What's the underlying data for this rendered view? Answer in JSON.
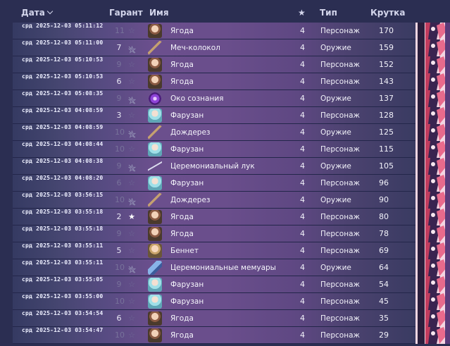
{
  "header": {
    "date_label": "Дата",
    "guarantee_label": "Гарант",
    "name_label": "Имя",
    "rarity_label": "★",
    "type_label": "Тип",
    "roll_label": "Крутка"
  },
  "rows": [
    {
      "date": "срд 2025-12-03 05:11:12",
      "pity": "11",
      "pity_dim": true,
      "mark": "star",
      "mark_dim": true,
      "icon": "char-yagoda-icon",
      "icon_class": "ico-char",
      "name": "Ягода",
      "rarity": "4",
      "type": "Персонаж",
      "roll": "170"
    },
    {
      "date": "срд 2025-12-03 05:11:00",
      "pity": "7",
      "pity_dim": false,
      "mark": "nostar",
      "mark_dim": false,
      "icon": "weapon-sword-icon",
      "icon_class": "ico-sword",
      "name": "Меч-колокол",
      "rarity": "4",
      "type": "Оружие",
      "roll": "159"
    },
    {
      "date": "срд 2025-12-03 05:10:53",
      "pity": "9",
      "pity_dim": true,
      "mark": "star",
      "mark_dim": true,
      "icon": "char-yagoda-icon",
      "icon_class": "ico-char",
      "name": "Ягода",
      "rarity": "4",
      "type": "Персонаж",
      "roll": "152"
    },
    {
      "date": "срд 2025-12-03 05:10:53",
      "pity": "6",
      "pity_dim": false,
      "mark": "star",
      "mark_dim": true,
      "icon": "char-yagoda-icon",
      "icon_class": "ico-char",
      "name": "Ягода",
      "rarity": "4",
      "type": "Персонаж",
      "roll": "143"
    },
    {
      "date": "срд 2025-12-03 05:08:35",
      "pity": "9",
      "pity_dim": true,
      "mark": "nostar",
      "mark_dim": false,
      "icon": "weapon-eye-icon",
      "icon_class": "ico-eye",
      "name": "Око сознания",
      "rarity": "4",
      "type": "Оружие",
      "roll": "137"
    },
    {
      "date": "срд 2025-12-03 04:08:59",
      "pity": "3",
      "pity_dim": false,
      "mark": "star",
      "mark_dim": true,
      "icon": "char-faruzan-icon",
      "icon_class": "ico-char f",
      "name": "Фарузан",
      "rarity": "4",
      "type": "Персонаж",
      "roll": "128"
    },
    {
      "date": "срд 2025-12-03 04:08:59",
      "pity": "10",
      "pity_dim": true,
      "mark": "nostar",
      "mark_dim": false,
      "icon": "weapon-dozhderez-icon",
      "icon_class": "ico-sword",
      "name": "Дождерез",
      "rarity": "4",
      "type": "Оружие",
      "roll": "125"
    },
    {
      "date": "срд 2025-12-03 04:08:44",
      "pity": "10",
      "pity_dim": true,
      "mark": "star",
      "mark_dim": true,
      "icon": "char-faruzan-icon",
      "icon_class": "ico-char f",
      "name": "Фарузан",
      "rarity": "4",
      "type": "Персонаж",
      "roll": "115"
    },
    {
      "date": "срд 2025-12-03 04:08:38",
      "pity": "9",
      "pity_dim": true,
      "mark": "nostar",
      "mark_dim": false,
      "icon": "weapon-bow-icon",
      "icon_class": "ico-bow",
      "name": "Церемониальный лук",
      "rarity": "4",
      "type": "Оружие",
      "roll": "105"
    },
    {
      "date": "срд 2025-12-03 04:08:20",
      "pity": "6",
      "pity_dim": true,
      "mark": "star",
      "mark_dim": true,
      "icon": "char-faruzan-icon",
      "icon_class": "ico-char f",
      "name": "Фарузан",
      "rarity": "4",
      "type": "Персонаж",
      "roll": "96"
    },
    {
      "date": "срд 2025-12-03 03:56:15",
      "pity": "10",
      "pity_dim": true,
      "mark": "nostar",
      "mark_dim": false,
      "icon": "weapon-dozhderez-icon",
      "icon_class": "ico-sword",
      "name": "Дождерез",
      "rarity": "4",
      "type": "Оружие",
      "roll": "90"
    },
    {
      "date": "срд 2025-12-03 03:55:18",
      "pity": "2",
      "pity_dim": false,
      "mark": "star",
      "mark_dim": false,
      "icon": "char-yagoda-icon",
      "icon_class": "ico-char",
      "name": "Ягода",
      "rarity": "4",
      "type": "Персонаж",
      "roll": "80"
    },
    {
      "date": "срд 2025-12-03 03:55:18",
      "pity": "9",
      "pity_dim": true,
      "mark": "star",
      "mark_dim": true,
      "icon": "char-yagoda-icon",
      "icon_class": "ico-char",
      "name": "Ягода",
      "rarity": "4",
      "type": "Персонаж",
      "roll": "78"
    },
    {
      "date": "срд 2025-12-03 03:55:11",
      "pity": "5",
      "pity_dim": false,
      "mark": "star",
      "mark_dim": true,
      "icon": "char-bennett-icon",
      "icon_class": "ico-char b",
      "name": "Беннет",
      "rarity": "4",
      "type": "Персонаж",
      "roll": "69"
    },
    {
      "date": "срд 2025-12-03 03:55:11",
      "pity": "10",
      "pity_dim": true,
      "mark": "nostar",
      "mark_dim": false,
      "icon": "weapon-memoirs-icon",
      "icon_class": "ico-mem",
      "name": "Церемониальные мемуары",
      "rarity": "4",
      "type": "Оружие",
      "roll": "64"
    },
    {
      "date": "срд 2025-12-03 03:55:05",
      "pity": "9",
      "pity_dim": true,
      "mark": "star",
      "mark_dim": true,
      "icon": "char-faruzan-icon",
      "icon_class": "ico-char f",
      "name": "Фарузан",
      "rarity": "4",
      "type": "Персонаж",
      "roll": "54"
    },
    {
      "date": "срд 2025-12-03 03:55:00",
      "pity": "10",
      "pity_dim": true,
      "mark": "star",
      "mark_dim": true,
      "icon": "char-faruzan-icon",
      "icon_class": "ico-char f",
      "name": "Фарузан",
      "rarity": "4",
      "type": "Персонаж",
      "roll": "45"
    },
    {
      "date": "срд 2025-12-03 03:54:54",
      "pity": "6",
      "pity_dim": false,
      "mark": "star",
      "mark_dim": true,
      "icon": "char-yagoda-icon",
      "icon_class": "ico-char",
      "name": "Ягода",
      "rarity": "4",
      "type": "Персонаж",
      "roll": "35"
    },
    {
      "date": "срд 2025-12-03 03:54:47",
      "pity": "10",
      "pity_dim": true,
      "mark": "star",
      "mark_dim": true,
      "icon": "char-yagoda-icon",
      "icon_class": "ico-char",
      "name": "Ягода",
      "rarity": "4",
      "type": "Персонаж",
      "roll": "29"
    }
  ]
}
